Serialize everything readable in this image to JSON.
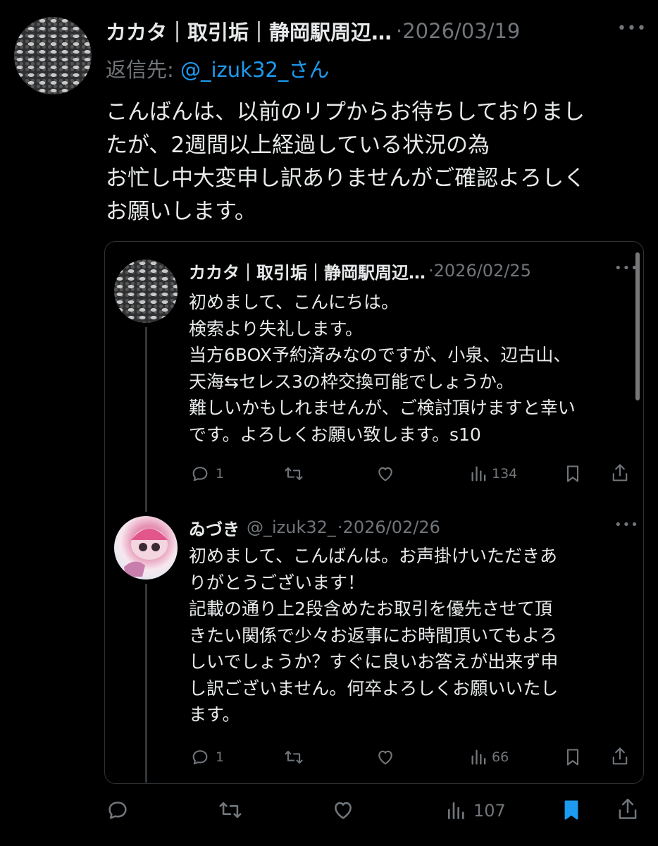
{
  "main_tweet": {
    "author_name": "カカタ｜取引垢｜静岡駅周辺…",
    "date": "·2026/03/19",
    "reply_label": "返信先:",
    "reply_to": "@_izuk32_さん",
    "text_lines": [
      "こんばんは、以前のリプからお待ちしておりまし",
      "たが、2週間以上経過している状況の為",
      "お忙し中大変申し訳ありませんがご確認よろしく",
      "お願いします。"
    ],
    "views": "107",
    "bookmarked": true
  },
  "quoted_thread": {
    "tweet1": {
      "author_name": "カカタ｜取引垢｜静岡駅周辺…",
      "date": "·2026/02/25",
      "text_lines": [
        "初めまして、こんにちは。",
        "検索より失礼します。",
        "当方6BOX予約済みなのですが、小泉、辺古山、",
        "天海⇆セレス3の枠交換可能でしょうか。",
        "難しいかもしれませんが、ご検討頂けますと幸い",
        "です。よろしくお願い致します。s10"
      ],
      "replies": "1",
      "views": "134"
    },
    "tweet2": {
      "author_name": "ゐづき",
      "handle": "@_izuk32_",
      "date": "·2026/02/26",
      "text_lines": [
        "初めまして、こんばんは。お声掛けいただきあ",
        "りがとうございます！",
        "記載の通り上2段含めたお取引を優先させて頂",
        "きたい関係で少々お返事にお時間頂いてもよろ",
        "しいでしょうか？すぐに良いお答えが出来ず申",
        "し訳ございません。何卒よろしくお願いいたし",
        "ます。"
      ],
      "replies": "1",
      "views": "66"
    }
  },
  "colors": {
    "background": "#000000",
    "text": "#e7e9ea",
    "muted": "#71767b",
    "link": "#1d9bf0",
    "bookmark_active": "#1d9bf0"
  },
  "icons": [
    "reply-icon",
    "retweet-icon",
    "like-icon",
    "views-icon",
    "bookmark-icon",
    "share-icon",
    "more-icon"
  ]
}
